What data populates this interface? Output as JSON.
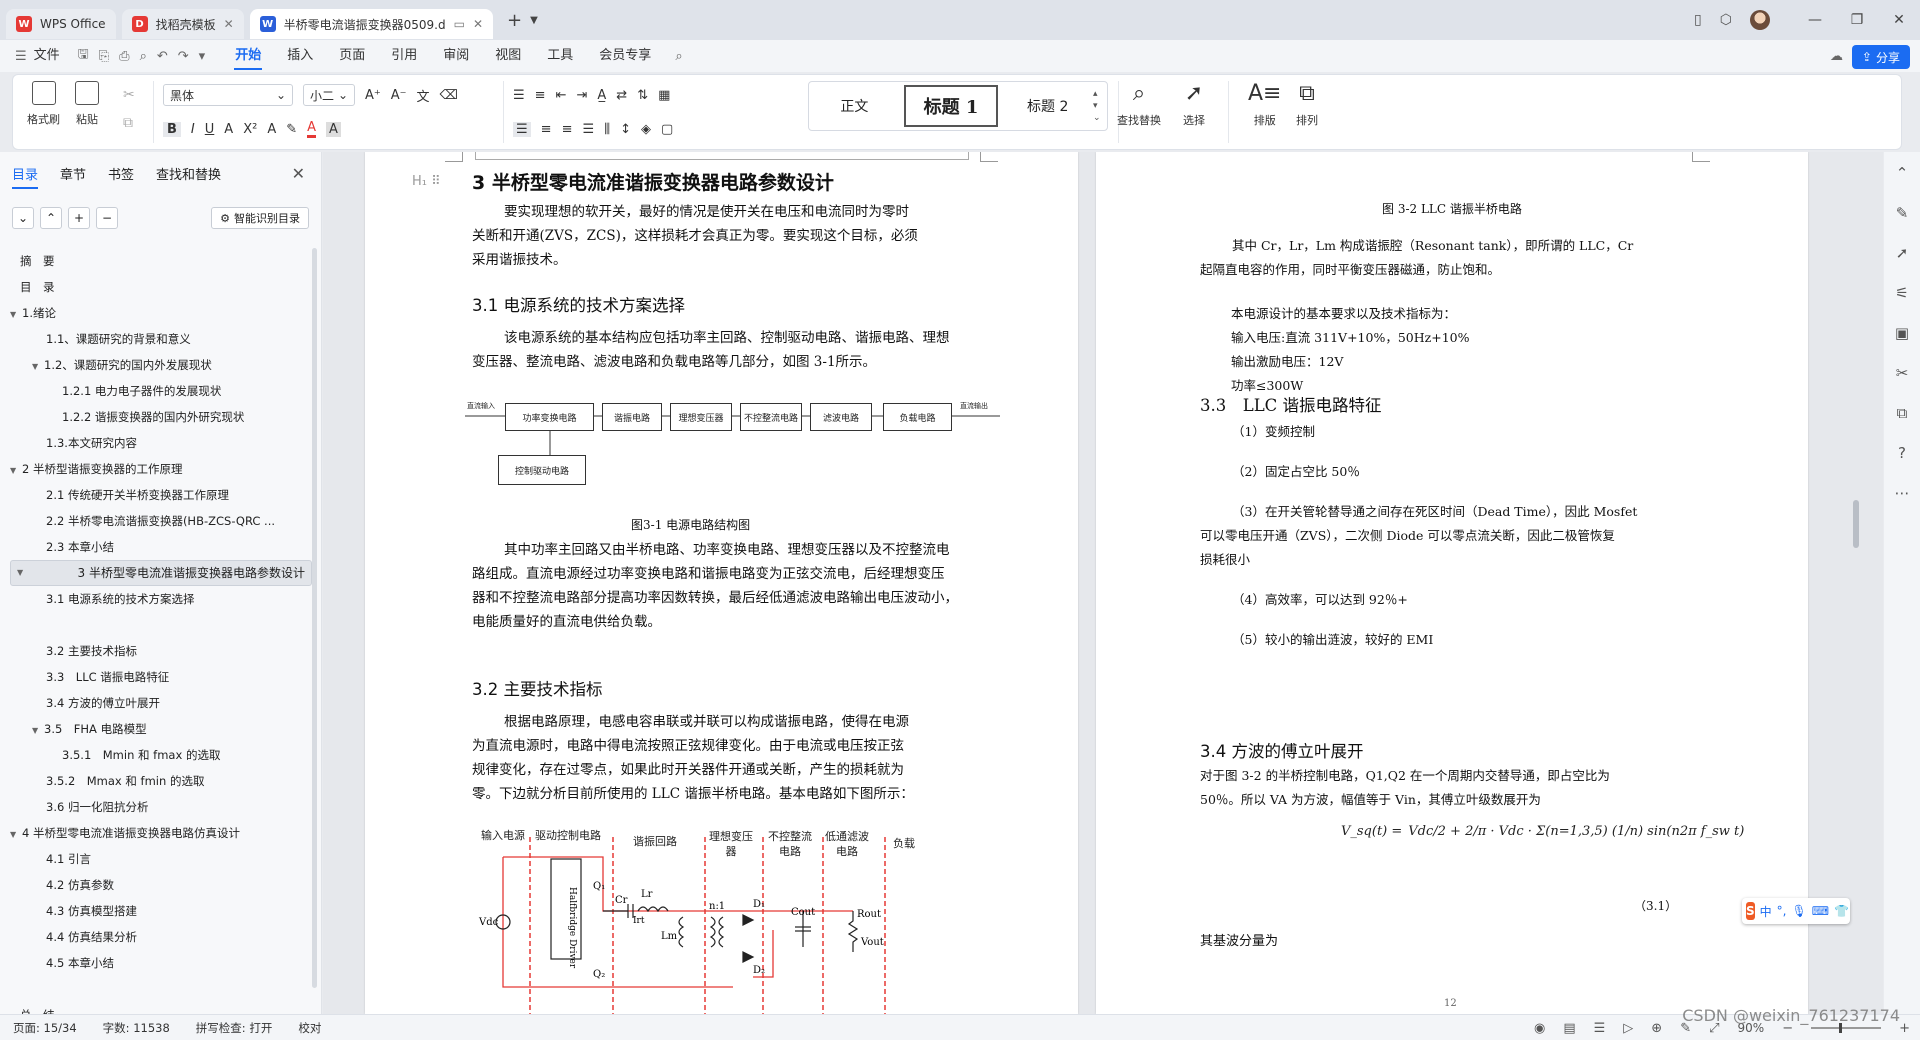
{
  "titlebar": {
    "tabs": [
      {
        "label": "WPS Office",
        "color": "#e53935",
        "logo": "W"
      },
      {
        "label": "找稻壳模板",
        "color": "#e53935",
        "logo": "D"
      },
      {
        "label": "半桥零电流谐振变换器0509.d",
        "color": "#2b5fd9",
        "logo": "W"
      }
    ],
    "new_tab": "+"
  },
  "menu": {
    "file": "文件",
    "items": [
      "开始",
      "插入",
      "页面",
      "引用",
      "审阅",
      "视图",
      "工具",
      "会员专享"
    ],
    "active": "开始",
    "share": "分享"
  },
  "ribbon": {
    "format_painter": "格式刷",
    "paste": "粘贴",
    "font_name": "黑体",
    "font_size": "小二",
    "styles": [
      "正文",
      "标题 1",
      "标题 2"
    ],
    "find_replace": "查找替换",
    "select": "选择",
    "sort": "排版",
    "arrange": "排列"
  },
  "leftpanel": {
    "tabs": [
      "目录",
      "章节",
      "书签",
      "查找和替换"
    ],
    "smart_btn": "智能识别目录",
    "toc": [
      {
        "label": "摘　要",
        "level": 1,
        "arrow": ""
      },
      {
        "label": "目　录",
        "level": 1,
        "arrow": ""
      },
      {
        "label": "1.绪论",
        "level": 1,
        "arrow": "▼"
      },
      {
        "label": "1.1、课题研究的背景和意义",
        "level": 2,
        "arrow": ""
      },
      {
        "label": "1.2、课题研究的国内外发展现状",
        "level": 2,
        "arrow": "▼"
      },
      {
        "label": "1.2.1 电力电子器件的发展现状",
        "level": 3,
        "arrow": ""
      },
      {
        "label": "1.2.2 谐振变换器的国内外研究现状",
        "level": 3,
        "arrow": ""
      },
      {
        "label": "1.3.本文研究内容",
        "level": 2,
        "arrow": ""
      },
      {
        "label": "2 半桥型谐振变换器的工作原理",
        "level": 1,
        "arrow": "▼"
      },
      {
        "label": "2.1 传统硬开关半桥变换器工作原理",
        "level": 2,
        "arrow": ""
      },
      {
        "label": "2.2 半桥零电流谐振变换器(HB-ZCS-QRC ...",
        "level": 2,
        "arrow": ""
      },
      {
        "label": "2.3 本章小结",
        "level": 2,
        "arrow": ""
      },
      {
        "label": "3 半桥型零电流准谐振变换器电路参数设计",
        "level": 1,
        "arrow": "▼",
        "selected": true
      },
      {
        "label": "3.1 电源系统的技术方案选择",
        "level": 2,
        "arrow": ""
      },
      {
        "label": "",
        "level": 2,
        "arrow": ""
      },
      {
        "label": "3.2 主要技术指标",
        "level": 2,
        "arrow": ""
      },
      {
        "label": "3.3　LLC 谐振电路特征",
        "level": 2,
        "arrow": ""
      },
      {
        "label": "3.4 方波的傅立叶展开",
        "level": 2,
        "arrow": ""
      },
      {
        "label": "3.5　FHA 电路模型",
        "level": 2,
        "arrow": "▼"
      },
      {
        "label": "3.5.1　Mmin 和 fmax 的选取",
        "level": 3,
        "arrow": ""
      },
      {
        "label": "3.5.2　Mmax 和 fmin 的选取",
        "level": 2,
        "arrow": ""
      },
      {
        "label": "3.6 归一化阻抗分析",
        "level": 2,
        "arrow": ""
      },
      {
        "label": "4 半桥型零电流准谐振变换器电路仿真设计",
        "level": 1,
        "arrow": "▼"
      },
      {
        "label": "4.1 引言",
        "level": 2,
        "arrow": ""
      },
      {
        "label": "4.2 仿真参数",
        "level": 2,
        "arrow": ""
      },
      {
        "label": "4.3 仿真模型搭建",
        "level": 2,
        "arrow": ""
      },
      {
        "label": "4.4 仿真结果分析",
        "level": 2,
        "arrow": ""
      },
      {
        "label": "4.5 本章小结",
        "level": 2,
        "arrow": ""
      },
      {
        "label": "",
        "level": 1,
        "arrow": ""
      },
      {
        "label": "总　结",
        "level": 1,
        "arrow": ""
      }
    ]
  },
  "page1": {
    "h1": "3 半桥型零电流准谐振变换器电路参数设计",
    "p1a": "要实现理想的软开关，最好的情况是使开关在电压和电流同时为零时",
    "p1b": "关断和开通(ZVS，ZCS)，这样损耗才会真正为零。要实现这个目标，必须",
    "p1c": "采用谐振技术。",
    "h31": "3.1 电源系统的技术方案选择",
    "p2a": "该电源系统的基本结构应包括功率主回路、控制驱动电路、谐振电路、理想",
    "p2b": "变压器、整流电路、滤波电路和负载电路等几部分，如图 3-1所示。",
    "blocks": [
      "功率变换电路",
      "谐振电路",
      "理想变压器",
      "不控整流电路",
      "滤波电路",
      "负载电路",
      "控制驱动电路"
    ],
    "bd_in": "直流输入",
    "bd_out": "直流输出",
    "fig31": "图3-1 电源电路结构图",
    "p3a": "其中功率主回路又由半桥电路、功率变换电路、理想变压器以及不控整流电",
    "p3b": "路组成。直流电源经过功率变换电路和谐振电路变为正弦交流电，后经理想变压",
    "p3c": "器和不控整流电路部分提高功率因数转换，最后经低通滤波电路输出电压波动小，",
    "p3d": "电能质量好的直流电供给负载。",
    "h32": "3.2 主要技术指标",
    "p4a": "根据电路原理，电感电容串联或并联可以构成谐振电路，使得在电源",
    "p4b": "为直流电源时，电路中得电流按照正弦规律变化。由于电流或电压按正弦",
    "p4c": "规律变化，存在过零点，如果此时开关器件开通或关断，产生的损耗就为",
    "p4d": "零。下边就分析目前所使用的 LLC 谐振半桥电路。基本电路如下图所示：",
    "circuit_labels": [
      "输入电源",
      "驱动控制电路",
      "谐振回路",
      "理想变压器",
      "不控整流电路",
      "低通滤波电路",
      "负载"
    ],
    "circuit_driver": "Halfbridge Driver",
    "circuit_syms": [
      "Q1",
      "Q2",
      "Cr",
      "Lr",
      "Lm",
      "Irt",
      "n:1",
      "D1",
      "D2",
      "Cout",
      "Rout",
      "Vout",
      "Vdc"
    ]
  },
  "page2": {
    "fig32": "图 3-2 LLC 谐振半桥电路",
    "p1a": "其中 Cr，Lr，Lm 构成谐振腔（Resonant tank），即所谓的 LLC，Cr",
    "p1b": "起隔直电容的作用，同时平衡变压器磁通，防止饱和。",
    "req0": "本电源设计的基本要求以及技术指标为：",
    "req1": "输入电压:直流 311V+10%，50Hz+10%",
    "req2": "输出激励电压：12V",
    "req3": "功率≤300W",
    "h33": "3.3　LLC 谐振电路特征",
    "f1": "（1）变频控制",
    "f2": "（2）固定占空比 50％",
    "f3a": "（3）在开关管轮替导通之间存在死区时间（Dead Time），因此 Mosfet",
    "f3b": "可以零电压开通（ZVS），二次侧 Diode 可以零点流关断，因此二极管恢复",
    "f3c": "损耗很小",
    "f4": "（4）高效率，可以达到 92％+",
    "f5": "（5）较小的输出涟波，较好的 EMI",
    "h34": "3.4 方波的傅立叶展开",
    "p2a": "对于图 3-2 的半桥控制电路，Q1,Q2 在一个周期内交替导通，即占空比为",
    "p2b": "50％。所以 VA 为方波，幅值等于 Vin，其傅立叶级数展开为",
    "eq_lhs": "V_sq(t) =",
    "eq_rhs": "Vdc/2 + 2/π · Vdc · Σ(n=1,3,5) (1/n) sin(n2π f_sw t)",
    "eq_no": "（3.1）",
    "p3": "其基波分量为",
    "page_no": "12"
  },
  "ime": {
    "icons": [
      "中",
      "°,",
      "mic",
      "kbd",
      "shirt",
      "grid"
    ]
  },
  "status": {
    "page": "页面: 15/34",
    "words": "字数: 11538",
    "spell": "拼写检查: 打开",
    "proof": "校对",
    "zoom": "90%"
  },
  "watermark": "CSDN @weixin_761237174"
}
